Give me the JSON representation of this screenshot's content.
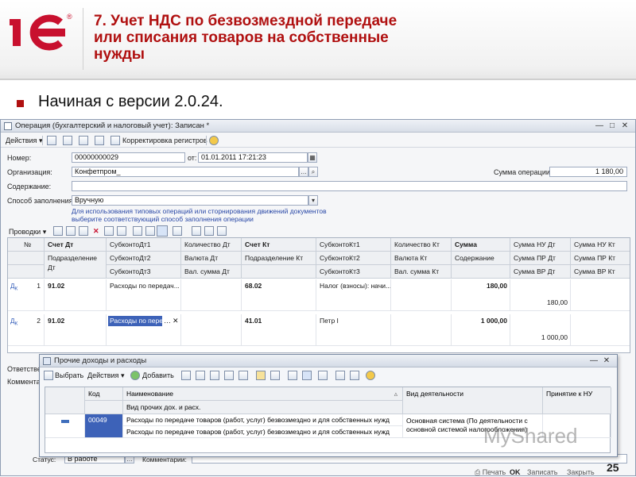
{
  "slide": {
    "logo_text": "1С",
    "logo_mark": "®",
    "title_line1": "7. Учет НДС по безвозмездной передаче",
    "title_line2": "или списания товаров на собственные",
    "title_line3": "нужды",
    "bullet": "Начиная с версии 2.0.24.",
    "page_number": "25",
    "watermark": "MyShared"
  },
  "window": {
    "title": "Операция (бухгалтерский и налоговый учет): Записан *",
    "toolbar": {
      "actions": "Действия",
      "correct_registers": "Корректировка регистров"
    },
    "form": {
      "number_label": "Номер:",
      "number_value": "00000000029",
      "date_label": "от:",
      "date_value": "01.01.2011 17:21:23",
      "org_label": "Организация:",
      "org_value": "Конфетпром_",
      "sum_label": "Сумма операции:",
      "sum_value": "1 180,00",
      "content_label": "Содержание:",
      "fill_label": "Способ заполнения:",
      "fill_value": "Вручную",
      "hint_line1": "Для использования типовых операций или сторнирования движений документов",
      "hint_line2": "выберите соответствующий способ заполнения операции"
    },
    "postings_label": "Проводки",
    "grid": {
      "headers_row1": [
        "№",
        "Счет Дт",
        "СубконтоДт1",
        "Количество Дт",
        "Счет Кт",
        "СубконтоКт1",
        "Количество Кт",
        "Сумма",
        "Сумма НУ Дт",
        "Сумма НУ Кт"
      ],
      "headers_row2": [
        "Подразделение Дт",
        "СубконтоДт2",
        "Валюта Дт",
        "Подразделение Кт",
        "СубконтоКт2",
        "Валюта Кт",
        "Содержание",
        "Сумма ПР Дт",
        "Сумма ПР Кт"
      ],
      "headers_row3": [
        "СубконтоДт3",
        "Вал. сумма Дт",
        "СубконтоКт3",
        "Вал. сумма Кт",
        "Сумма ВР Дт",
        "Сумма ВР Кт"
      ],
      "rows": [
        {
          "n": "1",
          "dt": "91.02",
          "sub_dt1": "Расходы по передач...",
          "kt": "68.02",
          "sub_kt1": "Налог (взносы): начи...",
          "sum": "180,00",
          "sum_nu_dt": "180,00"
        },
        {
          "n": "2",
          "dt": "91.02",
          "sub_dt1": "Расходы по пере",
          "kt": "41.01",
          "sub_kt1": "Петр I",
          "sum": "1 000,00",
          "sum_nu_dt": "1 000,00"
        }
      ]
    },
    "bottom": {
      "responsible_label": "Ответстве",
      "comment_label": "Коммента",
      "status_label": "Статус:",
      "status_value": "В работе",
      "comment2_label": "Комментарии:"
    },
    "footer_buttons": {
      "print": "Печать",
      "ok": "OK",
      "write": "Записать",
      "close": "Закрыть"
    }
  },
  "popup": {
    "title": "Прочие доходы и расходы",
    "toolbar": {
      "select": "Выбрать",
      "actions": "Действия",
      "add": "Добавить"
    },
    "headers": {
      "code": "Код",
      "name": "Наименование",
      "kind": "Вид деятельности",
      "accept": "Принятие к НУ",
      "subheader": "Вид прочих дох. и расх."
    },
    "row": {
      "code": "00049",
      "name": "Расходы по передаче товаров (работ, услуг) безвозмездно и для собственных нужд",
      "name2": "Расходы по передаче товаров (работ, услуг) безвозмездно и для собственных нужд",
      "kind_line1": "Основная система (По деятельности с",
      "kind_line2": "основной системой налогообложения)"
    }
  }
}
